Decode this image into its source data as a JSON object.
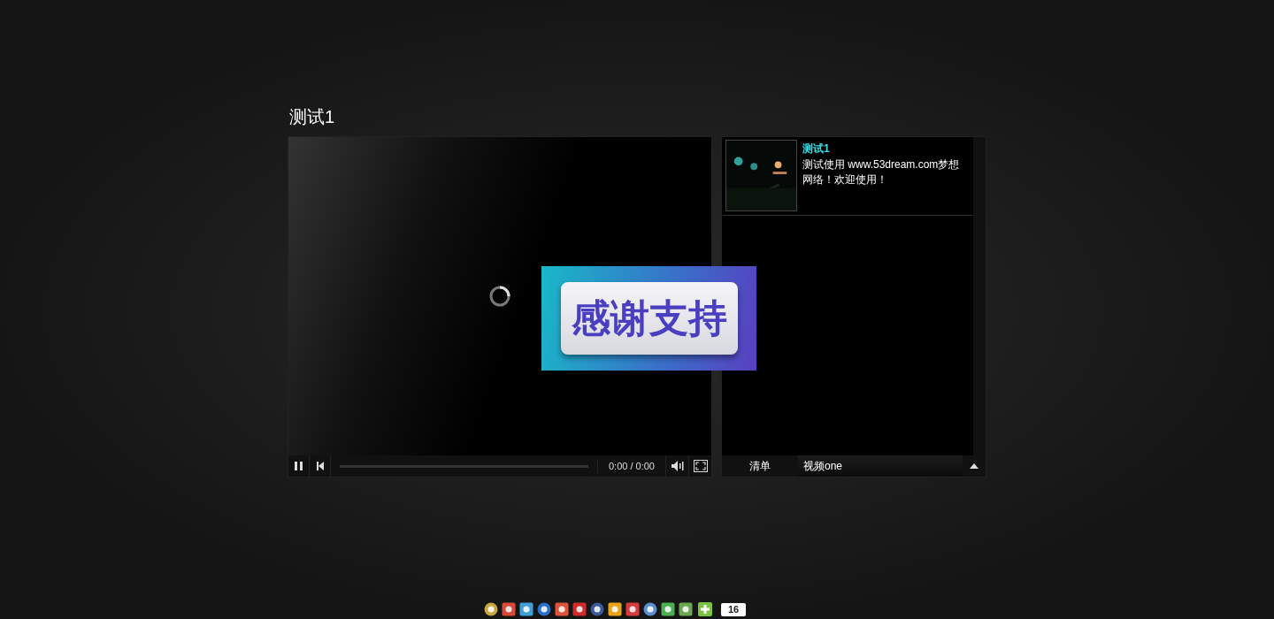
{
  "page_title": "测试1",
  "player": {
    "time": "0:00 / 0:00",
    "progress": {
      "level": 0
    }
  },
  "playlist": {
    "items": [
      {
        "title": "测试1",
        "description": "测试使用 www.53dream.com梦想网络！欢迎使用！"
      }
    ],
    "tab_label": "清单",
    "current": "视频one"
  },
  "banner": {
    "text": "感谢支持"
  },
  "share_bar": {
    "count": "16"
  }
}
